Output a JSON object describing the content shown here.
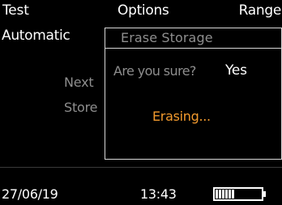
{
  "menu": {
    "test": "Test",
    "options": "Options",
    "range": "Range"
  },
  "background": {
    "mode_value": "Automatic",
    "next_label": "Next",
    "store_label": "Store"
  },
  "dialog": {
    "title": "Erase Storage",
    "question": "Are you sure?",
    "answer": "Yes",
    "status": "Erasing..."
  },
  "status_bar": {
    "date": "27/06/19",
    "time": "13:43",
    "battery_level": 0.6
  },
  "colors": {
    "background": "#000000",
    "text": "#ffffff",
    "muted_text": "#8e8e8e",
    "accent": "#f29a2e",
    "border": "#d8d8d8"
  }
}
